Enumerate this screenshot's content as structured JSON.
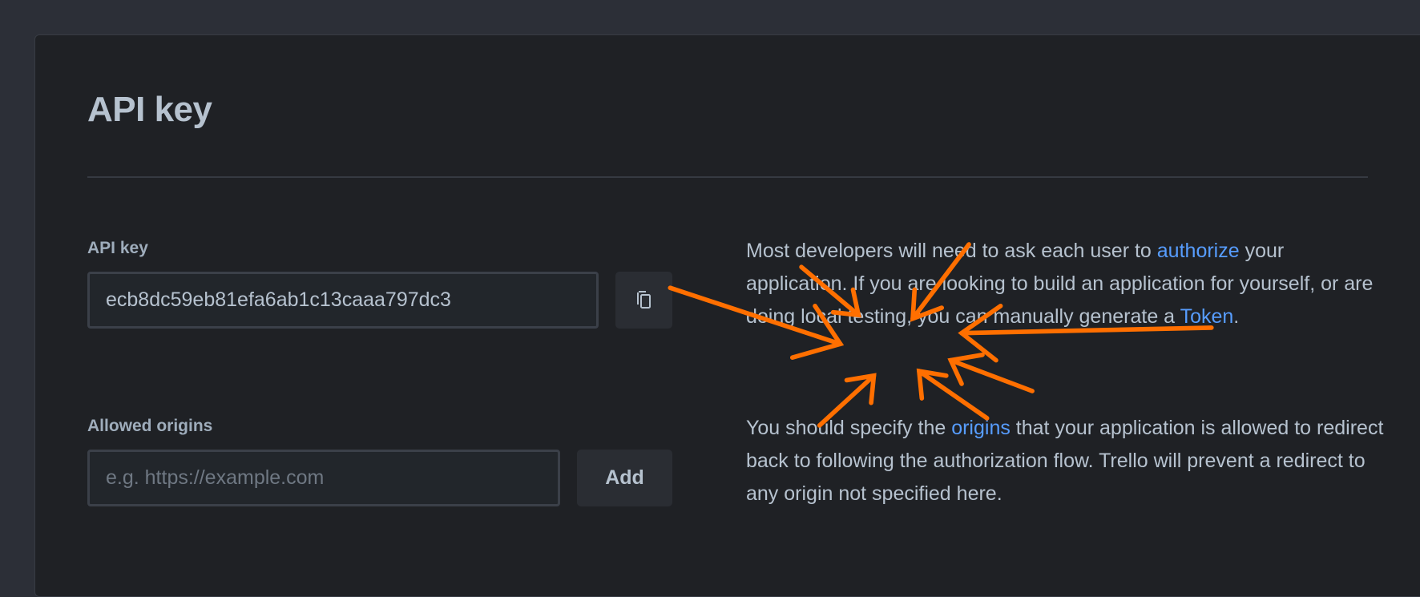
{
  "page": {
    "title": "API key"
  },
  "api_key": {
    "label": "API key",
    "value": "ecb8dc59eb81efa6ab1c13caaa797dc3",
    "copy_icon": "copy-icon"
  },
  "origins": {
    "label": "Allowed origins",
    "placeholder": "e.g. https://example.com",
    "value": "",
    "add_label": "Add"
  },
  "help": {
    "p1_before": "Most developers will need to ask each user to ",
    "p1_link1": "authorize",
    "p1_middle": " your application. If you are looking to build an application for yourself, or are doing local testing, you can manually generate a ",
    "p1_link2": "Token",
    "p1_after": ".",
    "p2_before": "You should specify the ",
    "p2_link": "origins",
    "p2_after": " that your application is allowed to redirect back to following the authorization flow. Trello will prevent a redirect to any origin not specified here."
  },
  "colors": {
    "accent_link": "#579dff",
    "annotation": "#ff6f00",
    "background": "#1f2125"
  }
}
